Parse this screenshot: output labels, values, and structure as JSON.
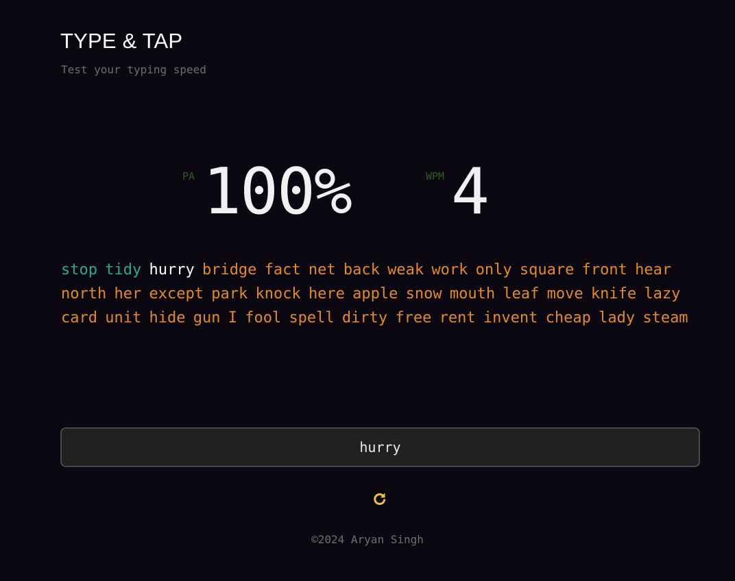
{
  "header": {
    "title": "TYPE & TAP",
    "subtitle": "Test your typing speed"
  },
  "stats": {
    "pa_label": "PA",
    "pa_value": "100%",
    "wpm_label": "WPM",
    "wpm_value": "4"
  },
  "words": [
    {
      "text": "stop",
      "state": "done"
    },
    {
      "text": "tidy",
      "state": "done"
    },
    {
      "text": "hurry",
      "state": "current"
    },
    {
      "text": "bridge",
      "state": "pending"
    },
    {
      "text": "fact",
      "state": "pending"
    },
    {
      "text": "net",
      "state": "pending"
    },
    {
      "text": "back",
      "state": "pending"
    },
    {
      "text": "weak",
      "state": "pending"
    },
    {
      "text": "work",
      "state": "pending"
    },
    {
      "text": "only",
      "state": "pending"
    },
    {
      "text": "square",
      "state": "pending"
    },
    {
      "text": "front",
      "state": "pending"
    },
    {
      "text": "hear",
      "state": "pending"
    },
    {
      "text": "north",
      "state": "pending"
    },
    {
      "text": "her",
      "state": "pending"
    },
    {
      "text": "except",
      "state": "pending"
    },
    {
      "text": "park",
      "state": "pending"
    },
    {
      "text": "knock",
      "state": "pending"
    },
    {
      "text": "here",
      "state": "pending"
    },
    {
      "text": "apple",
      "state": "pending"
    },
    {
      "text": "snow",
      "state": "pending"
    },
    {
      "text": "mouth",
      "state": "pending"
    },
    {
      "text": "leaf",
      "state": "pending"
    },
    {
      "text": "move",
      "state": "pending"
    },
    {
      "text": "knife",
      "state": "pending"
    },
    {
      "text": "lazy",
      "state": "pending"
    },
    {
      "text": "card",
      "state": "pending"
    },
    {
      "text": "unit",
      "state": "pending"
    },
    {
      "text": "hide",
      "state": "pending"
    },
    {
      "text": "gun",
      "state": "pending"
    },
    {
      "text": "I",
      "state": "pending"
    },
    {
      "text": "fool",
      "state": "pending"
    },
    {
      "text": "spell",
      "state": "pending"
    },
    {
      "text": "dirty",
      "state": "pending"
    },
    {
      "text": "free",
      "state": "pending"
    },
    {
      "text": "rent",
      "state": "pending"
    },
    {
      "text": "invent",
      "state": "pending"
    },
    {
      "text": "cheap",
      "state": "pending"
    },
    {
      "text": "lady",
      "state": "pending"
    },
    {
      "text": "steam",
      "state": "pending"
    }
  ],
  "input": {
    "value": "hurry"
  },
  "restart": {
    "icon": "restart-icon",
    "color": "#f3c04a"
  },
  "footer": {
    "text": "©2024 Aryan Singh"
  },
  "colors": {
    "background": "#0b0812",
    "done_word": "#2ea98a",
    "current_word": "#ffffff",
    "pending_word": "#e28a2b",
    "stat_label": "#2e5a25"
  }
}
